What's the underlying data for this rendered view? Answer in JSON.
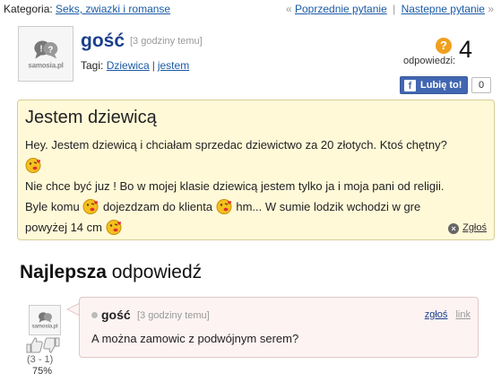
{
  "topbar": {
    "category_label": "Kategoria:",
    "category_link": "Seks, zwiazki i romanse",
    "prev_arrow": "«",
    "prev_label": "Poprzednie pytanie",
    "divider": "|",
    "next_label": "Nastepne pytanie",
    "next_arrow": "»"
  },
  "question": {
    "author": "gość",
    "time": "[3 godziny temu]",
    "tags_label": "Tagi:",
    "tags": [
      "Dziewica",
      "jestem"
    ],
    "tag_separator": "|",
    "answers_label": "odpowiedzi:",
    "answers_count": "4",
    "title": "Jestem dziewicą",
    "lines": [
      "Hey. Jestem dziewicą i chciałam sprzedac dziewictwo za 20 złotych. Ktoś chętny?",
      "Nie chce być juz ! Bo w mojej klasie dziewicą jestem tylko ja i moja pani od religii.",
      "Byle komu",
      "dojezdzam do klienta",
      "hm... W sumie lodzik wchodzi w gre",
      "powyżej 14 cm"
    ],
    "report_label": "Zgłoś"
  },
  "facebook": {
    "icon_letter": "f",
    "like_label": "Lubię to!",
    "like_count": "0"
  },
  "avatar": {
    "brand": "samosia.pl"
  },
  "best_answer": {
    "heading_bold": "Najlepsza",
    "heading_rest": "odpowiedź",
    "author": "gość",
    "time": "[3 godziny temu]",
    "report_label": "zgłoś",
    "link_label": "link",
    "text": "A można zamowic z podwójnym serem?",
    "votes": "(3 - 1)",
    "percent": "75%"
  },
  "colors": {
    "link": "#1a5aa6",
    "question_bg": "#fff9d8",
    "answer_bg": "#fdf3f3",
    "facebook": "#4267b2",
    "answers_icon": "#f0a020"
  }
}
